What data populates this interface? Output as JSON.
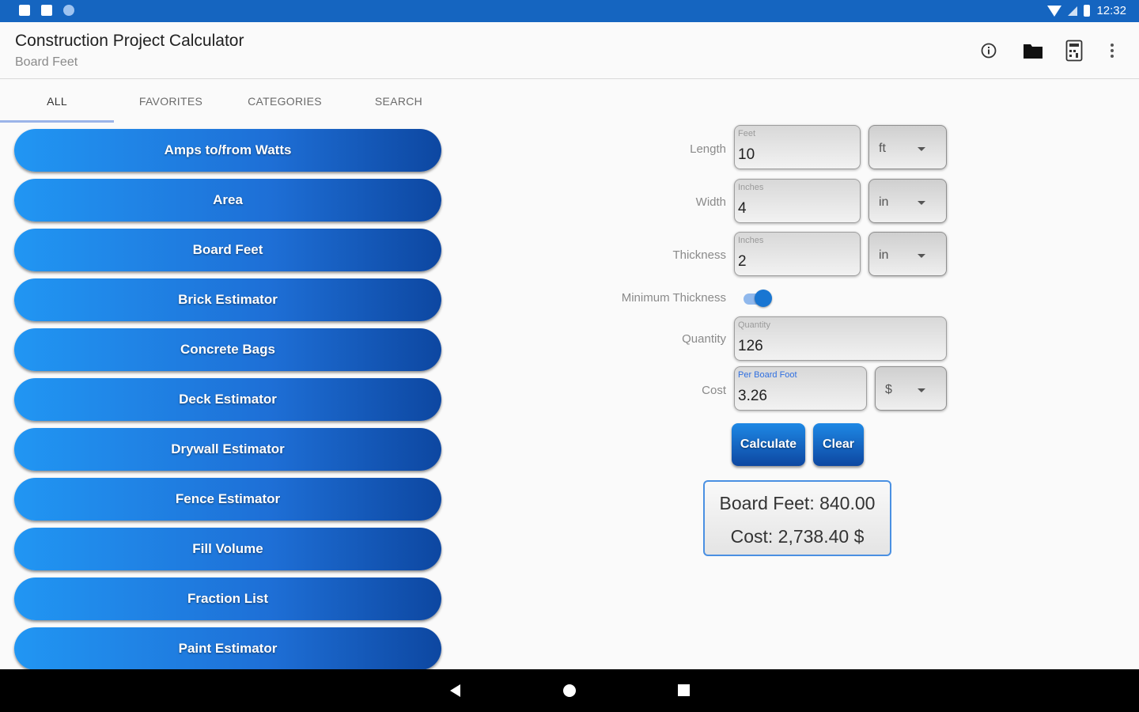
{
  "status_bar": {
    "time": "12:32"
  },
  "app_bar": {
    "title": "Construction Project Calculator",
    "subtitle": "Board Feet",
    "icons": [
      "info-icon",
      "folder-icon",
      "calculator-icon",
      "more-vert-icon"
    ]
  },
  "tabs": [
    {
      "label": "ALL",
      "active": true
    },
    {
      "label": "FAVORITES",
      "active": false
    },
    {
      "label": "CATEGORIES",
      "active": false
    },
    {
      "label": "SEARCH",
      "active": false
    }
  ],
  "calculators": [
    "Amps to/from Watts",
    "Area",
    "Board Feet",
    "Brick Estimator",
    "Concrete Bags",
    "Deck Estimator",
    "Drywall Estimator",
    "Fence Estimator",
    "Fill Volume",
    "Fraction List",
    "Paint Estimator"
  ],
  "form": {
    "length": {
      "label": "Length",
      "hint": "Feet",
      "value": "10",
      "unit": "ft"
    },
    "width": {
      "label": "Width",
      "hint": "Inches",
      "value": "4",
      "unit": "in"
    },
    "thickness": {
      "label": "Thickness",
      "hint": "Inches",
      "value": "2",
      "unit": "in"
    },
    "minimum_thickness": {
      "label": "Minimum Thickness",
      "checked": true
    },
    "quantity": {
      "label": "Quantity",
      "hint": "Quantity",
      "value": "126"
    },
    "cost": {
      "label": "Cost",
      "hint": "Per Board Foot",
      "value": "3.26",
      "unit": "$"
    },
    "calculate_label": "Calculate",
    "clear_label": "Clear"
  },
  "result": {
    "board_feet": "Board Feet: 840.00",
    "cost": "Cost: 2,738.40 $"
  },
  "colors": {
    "status_bar": "#1565c0",
    "button_start": "#2196f3",
    "button_end": "#0d47a1",
    "accent": "#1976d2"
  }
}
